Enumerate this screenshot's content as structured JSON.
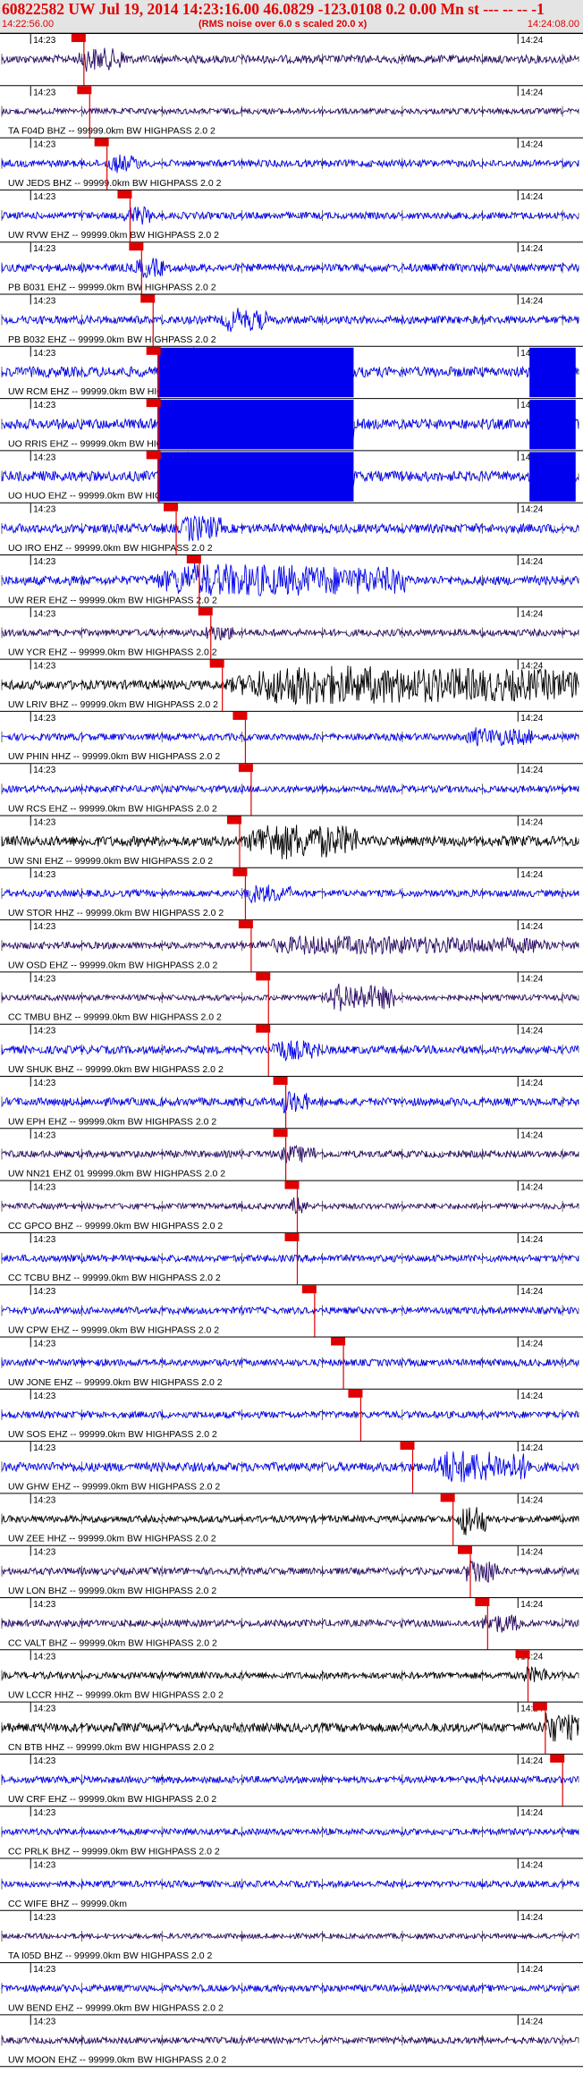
{
  "header": {
    "title": "60822582 UW Jul 19, 2014 14:23:16.00   46.0829 -123.0108  0.2 0.00 Mn st --- -- --  -1",
    "start_time": "14:22:56.00",
    "subtitle": "(RMS noise over 6.0 s scaled 20.0 x)",
    "end_time": "14:24:08.00"
  },
  "time_marks": [
    "14:23",
    "14:24"
  ],
  "colors": {
    "title": "#e00000",
    "trace_blue": "#0000ee",
    "trace_navy": "#2a0a66",
    "trace_black": "#000000",
    "pick": "#e00000"
  },
  "channels": [
    {
      "label": "",
      "color": "navy",
      "amp": 0.35,
      "pick": 0.13,
      "burst_start": 0.13,
      "burst_end": 0.22,
      "burst_amp": 0.6,
      "clip": null
    },
    {
      "label": "TA F04D BHZ -- 99999.0km BW  HIGHPASS  2.0  2",
      "color": "navy",
      "amp": 0.25,
      "pick": 0.14,
      "burst_start": null,
      "burst_end": null,
      "burst_amp": 0,
      "clip": null
    },
    {
      "label": "UW JEDS BHZ -- 99999.0km BW  HIGHPASS  2.0  2",
      "color": "blue",
      "amp": 0.3,
      "pick": 0.17,
      "burst_start": 0.18,
      "burst_end": 0.24,
      "burst_amp": 0.45,
      "clip": null
    },
    {
      "label": "UW RVW EHZ -- 99999.0km BW  HIGHPASS  2.0  2",
      "color": "blue",
      "amp": 0.3,
      "pick": 0.21,
      "burst_start": 0.21,
      "burst_end": 0.26,
      "burst_amp": 0.5,
      "clip": null
    },
    {
      "label": "PB B031 EHZ -- 99999.0km BW  HIGHPASS  2.0  2",
      "color": "blue",
      "amp": 0.35,
      "pick": 0.23,
      "burst_start": 0.23,
      "burst_end": 0.28,
      "burst_amp": 0.5,
      "clip": null
    },
    {
      "label": "PB B032 EHZ -- 99999.0km BW  HIGHPASS  2.0  2",
      "color": "blue",
      "amp": 0.35,
      "pick": 0.25,
      "burst_start": 0.38,
      "burst_end": 0.46,
      "burst_amp": 0.6,
      "clip": null
    },
    {
      "label": "UW RCM EHZ -- 99999.0km BW  HIGHPASS  2.0  2",
      "color": "blue",
      "amp": 0.45,
      "pick": 0.26,
      "burst_start": 0.27,
      "burst_end": 0.61,
      "burst_amp": 1.4,
      "clip": "a"
    },
    {
      "label": "UO RRIS EHZ -- 99999.0km BW  HIGHPASS  2.0  2",
      "color": "blue",
      "amp": 0.45,
      "pick": 0.26,
      "burst_start": 0.27,
      "burst_end": 0.61,
      "burst_amp": 1.4,
      "clip": "b"
    },
    {
      "label": "UO HUO EHZ -- 99999.0km BW  HIGHPASS  2.0  2",
      "color": "blue",
      "amp": 0.45,
      "pick": 0.26,
      "burst_start": 0.27,
      "burst_end": 0.61,
      "burst_amp": 1.4,
      "clip": "c"
    },
    {
      "label": "UO IRO EHZ -- 99999.0km BW  HIGHPASS  2.0  2",
      "color": "blue",
      "amp": 0.4,
      "pick": 0.29,
      "burst_start": 0.31,
      "burst_end": 0.38,
      "burst_amp": 0.7,
      "clip": null
    },
    {
      "label": "UW RER EHZ -- 99999.0km BW  HIGHPASS  2.0  2",
      "color": "blue",
      "amp": 0.4,
      "pick": 0.33,
      "burst_start": 0.25,
      "burst_end": 0.7,
      "burst_amp": 0.9,
      "clip": null
    },
    {
      "label": "UW YCR EHZ -- 99999.0km BW  HIGHPASS  2.0  2",
      "color": "navy",
      "amp": 0.3,
      "pick": 0.35,
      "burst_start": 0.35,
      "burst_end": 0.4,
      "burst_amp": 0.4,
      "clip": null
    },
    {
      "label": "UW LRIV BHZ -- 99999.0km BW  HIGHPASS  2.0  2",
      "color": "black",
      "amp": 0.4,
      "pick": 0.37,
      "burst_start": 0.38,
      "burst_end": 1.0,
      "burst_amp": 1.1,
      "clip": null
    },
    {
      "label": "UW PHIN HHZ -- 99999.0km BW  HIGHPASS  2.0  2",
      "color": "blue",
      "amp": 0.3,
      "pick": 0.41,
      "burst_start": 0.8,
      "burst_end": 0.92,
      "burst_amp": 0.45,
      "clip": null
    },
    {
      "label": "UW RCS EHZ -- 99999.0km BW  HIGHPASS  2.0  2",
      "color": "blue",
      "amp": 0.3,
      "pick": 0.42,
      "burst_start": null,
      "burst_end": null,
      "burst_amp": 0,
      "clip": null
    },
    {
      "label": "UW SNI EHZ -- 99999.0km BW  HIGHPASS  2.0  2",
      "color": "black",
      "amp": 0.45,
      "pick": 0.4,
      "burst_start": 0.42,
      "burst_end": 0.62,
      "burst_amp": 1.0,
      "clip": null
    },
    {
      "label": "UW STOR HHZ -- 99999.0km BW  HIGHPASS  2.0  2",
      "color": "blue",
      "amp": 0.3,
      "pick": 0.41,
      "burst_start": 0.42,
      "burst_end": 0.5,
      "burst_amp": 0.45,
      "clip": null
    },
    {
      "label": "UW OSD EHZ -- 99999.0km BW  HIGHPASS  2.0  2",
      "color": "navy",
      "amp": 0.3,
      "pick": 0.42,
      "burst_start": 0.43,
      "burst_end": 0.95,
      "burst_amp": 0.45,
      "clip": null
    },
    {
      "label": "CC TMBU BHZ -- 99999.0km BW  HIGHPASS  2.0  2",
      "color": "navy",
      "amp": 0.25,
      "pick": 0.45,
      "burst_start": 0.56,
      "burst_end": 0.68,
      "burst_amp": 0.85,
      "clip": null
    },
    {
      "label": "UW SHUK BHZ -- 99999.0km BW  HIGHPASS  2.0  2",
      "color": "blue",
      "amp": 0.35,
      "pick": 0.45,
      "burst_start": 0.46,
      "burst_end": 0.55,
      "burst_amp": 0.5,
      "clip": null
    },
    {
      "label": "UW EPH EHZ -- 99999.0km BW  HIGHPASS  2.0  2",
      "color": "blue",
      "amp": 0.35,
      "pick": 0.48,
      "burst_start": 0.48,
      "burst_end": 0.53,
      "burst_amp": 0.6,
      "clip": null
    },
    {
      "label": "UW NN21 EHZ 01 99999.0km BW  HIGHPASS  2.0  2",
      "color": "navy",
      "amp": 0.3,
      "pick": 0.48,
      "burst_start": 0.48,
      "burst_end": 0.55,
      "burst_amp": 0.4,
      "clip": null
    },
    {
      "label": "CC GPCO BHZ -- 99999.0km BW  HIGHPASS  2.0  2",
      "color": "navy",
      "amp": 0.25,
      "pick": 0.5,
      "burst_start": 0.5,
      "burst_end": 0.53,
      "burst_amp": 0.5,
      "clip": null
    },
    {
      "label": "CC TCBU BHZ -- 99999.0km BW  HIGHPASS  2.0  2",
      "color": "blue",
      "amp": 0.3,
      "pick": 0.5,
      "burst_start": null,
      "burst_end": null,
      "burst_amp": 0,
      "clip": null
    },
    {
      "label": "UW CPW EHZ -- 99999.0km BW  HIGHPASS  2.0  2",
      "color": "blue",
      "amp": 0.3,
      "pick": 0.53,
      "burst_start": null,
      "burst_end": null,
      "burst_amp": 0,
      "clip": null
    },
    {
      "label": "UW JONE EHZ -- 99999.0km BW  HIGHPASS  2.0  2",
      "color": "blue",
      "amp": 0.3,
      "pick": 0.58,
      "burst_start": null,
      "burst_end": null,
      "burst_amp": 0,
      "clip": null
    },
    {
      "label": "UW SOS EHZ -- 99999.0km BW  HIGHPASS  2.0  2",
      "color": "blue",
      "amp": 0.3,
      "pick": 0.61,
      "burst_start": null,
      "burst_end": null,
      "burst_amp": 0,
      "clip": null
    },
    {
      "label": "UW GHW EHZ -- 99999.0km BW  HIGHPASS  2.0  2",
      "color": "blue",
      "amp": 0.4,
      "pick": 0.7,
      "burst_start": 0.74,
      "burst_end": 0.92,
      "burst_amp": 0.9,
      "clip": null
    },
    {
      "label": "UW ZEE HHZ -- 99999.0km BW  HIGHPASS  2.0  2",
      "color": "black",
      "amp": 0.3,
      "pick": 0.77,
      "burst_start": 0.79,
      "burst_end": 0.84,
      "burst_amp": 1.0,
      "clip": null
    },
    {
      "label": "UW LON BHZ -- 99999.0km BW  HIGHPASS  2.0  2",
      "color": "navy",
      "amp": 0.3,
      "pick": 0.8,
      "burst_start": 0.8,
      "burst_end": 0.86,
      "burst_amp": 0.8,
      "clip": null
    },
    {
      "label": "CC VALT BHZ -- 99999.0km BW  HIGHPASS  2.0  2",
      "color": "navy",
      "amp": 0.3,
      "pick": 0.83,
      "burst_start": 0.83,
      "burst_end": 0.9,
      "burst_amp": 0.5,
      "clip": null
    },
    {
      "label": "UW LCCR HHZ -- 99999.0km BW  HIGHPASS  2.0  2",
      "color": "black",
      "amp": 0.3,
      "pick": 0.9,
      "burst_start": 0.9,
      "burst_end": 0.95,
      "burst_amp": 0.4,
      "clip": null
    },
    {
      "label": "CN BTB HHZ -- 99999.0km BW  HIGHPASS  2.0  2",
      "color": "black",
      "amp": 0.4,
      "pick": 0.93,
      "burst_start": 0.93,
      "burst_end": 1.0,
      "burst_amp": 0.8,
      "clip": null
    },
    {
      "label": "UW CRF EHZ -- 99999.0km BW  HIGHPASS  2.0  2",
      "color": "blue",
      "amp": 0.3,
      "pick": 0.96,
      "burst_start": null,
      "burst_end": null,
      "burst_amp": 0,
      "clip": null
    },
    {
      "label": "CC PRLK BHZ -- 99999.0km BW  HIGHPASS  2.0  2",
      "color": "blue",
      "amp": 0.28,
      "pick": null,
      "burst_start": null,
      "burst_end": null,
      "burst_amp": 0,
      "clip": null
    },
    {
      "label": "CC WIFE BHZ -- 99999.0km",
      "color": "blue",
      "amp": 0.28,
      "pick": null,
      "burst_start": null,
      "burst_end": null,
      "burst_amp": 0,
      "clip": null
    },
    {
      "label": "TA I05D BHZ -- 99999.0km BW  HIGHPASS  2.0  2",
      "color": "navy",
      "amp": 0.22,
      "pick": null,
      "burst_start": null,
      "burst_end": null,
      "burst_amp": 0,
      "clip": null
    },
    {
      "label": "UW BEND EHZ -- 99999.0km BW  HIGHPASS  2.0  2",
      "color": "blue",
      "amp": 0.3,
      "pick": null,
      "burst_start": null,
      "burst_end": null,
      "burst_amp": 0,
      "clip": null
    },
    {
      "label": "UW MOON EHZ -- 99999.0km BW  HIGHPASS  2.0  2",
      "color": "navy",
      "amp": 0.28,
      "pick": null,
      "burst_start": null,
      "burst_end": null,
      "burst_amp": 0,
      "clip": null
    }
  ]
}
